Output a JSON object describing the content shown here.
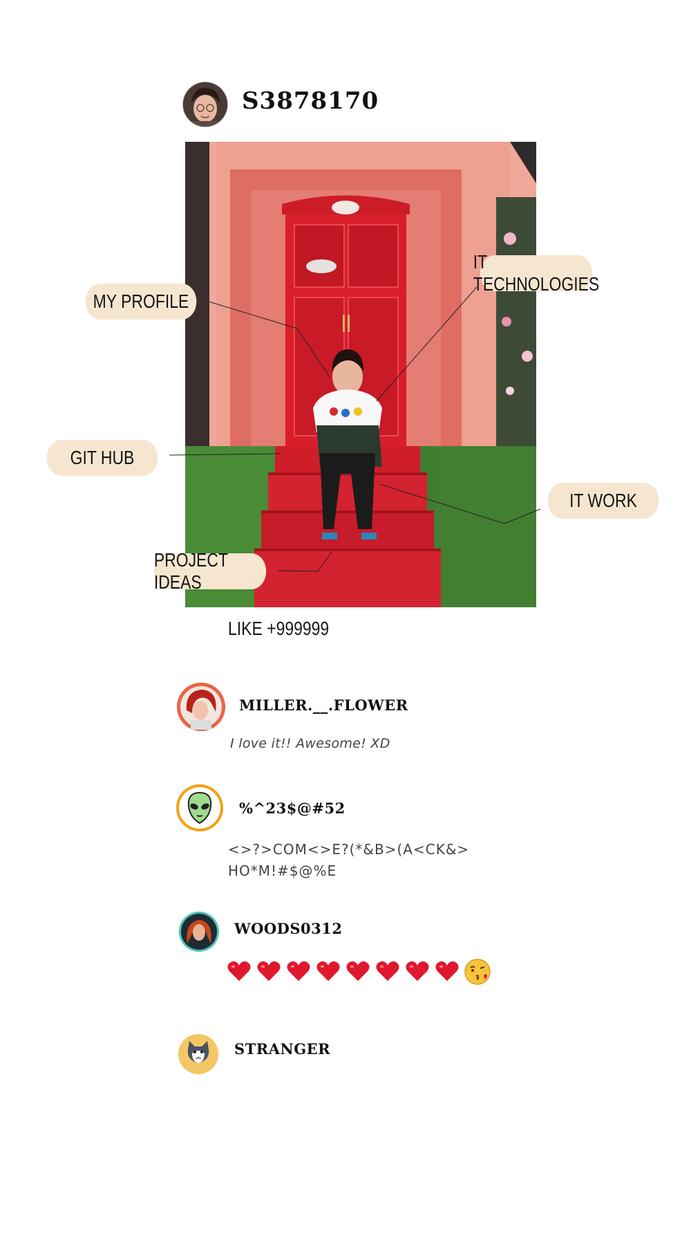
{
  "post": {
    "username": "S3878170",
    "likes": "LIKE +999999"
  },
  "callouts": {
    "my_profile": "MY PROFILE",
    "it_technologies": "IT TECHNOLOGIES",
    "git_hub": "GIT HUB",
    "it_work": "IT WORK",
    "project_ideas": "PROJECT IDEAS"
  },
  "comments": [
    {
      "username": "MILLER.__.FLOWER",
      "text": "I love it!! Awesome! XD",
      "avatar_icon": "redhead-avatar"
    },
    {
      "username": "%^23$@#52",
      "text_line1": "<>?>COM<>E?(*&B>(A<CK&>",
      "text_line2": "HO*M!#$@%E",
      "avatar_icon": "alien-icon"
    },
    {
      "username": "WOODS0312",
      "text": "",
      "avatar_icon": "woman-avatar",
      "reaction_icons": [
        "heart-icon",
        "heart-icon",
        "heart-icon",
        "heart-icon",
        "heart-icon",
        "heart-icon",
        "heart-icon",
        "heart-icon",
        "kiss-face-icon"
      ]
    },
    {
      "username": "STRANGER",
      "avatar_icon": "cat-icon"
    }
  ],
  "colors": {
    "pill_bg": "#f6e6cf",
    "door_red": "#d81e2b",
    "heart_red": "#e0182d"
  }
}
